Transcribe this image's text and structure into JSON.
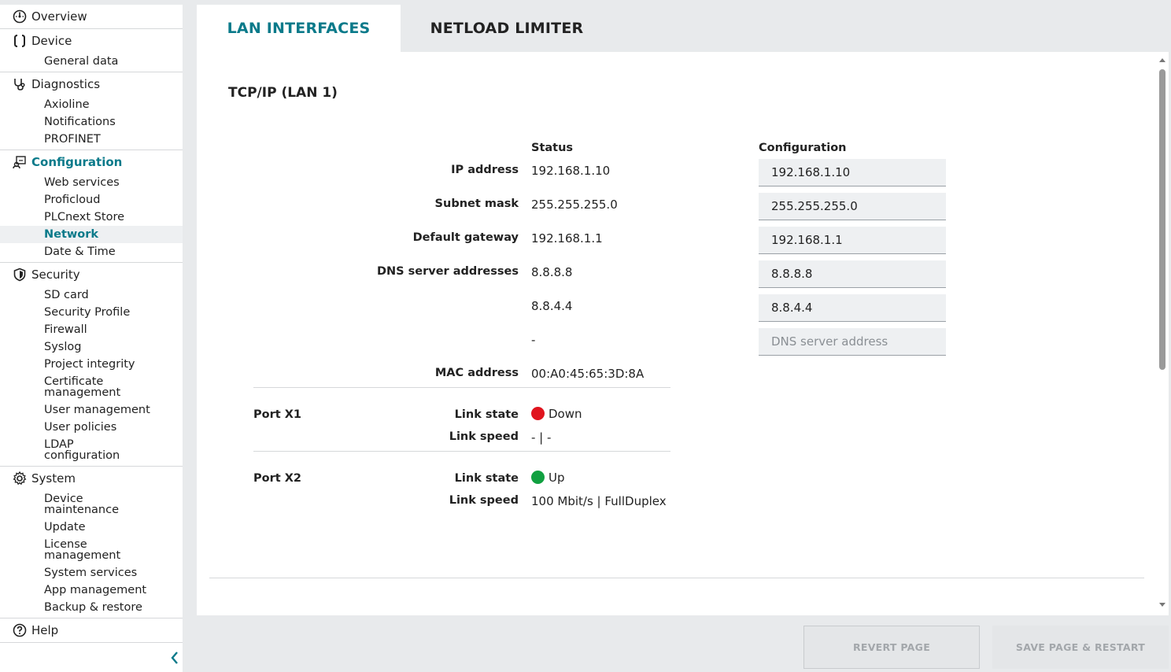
{
  "sidebar": {
    "groups": [
      {
        "label": "Overview",
        "icon": "dashboard-icon",
        "items": []
      },
      {
        "label": "Device",
        "icon": "braces-icon",
        "items": [
          "General data"
        ]
      },
      {
        "label": "Diagnostics",
        "icon": "stethoscope-icon",
        "items": [
          "Axioline",
          "Notifications",
          "PROFINET"
        ]
      },
      {
        "label": "Configuration",
        "icon": "config-icon",
        "items": [
          "Web services",
          "Proficloud",
          "PLCnext Store",
          "Network",
          "Date & Time"
        ]
      },
      {
        "label": "Security",
        "icon": "shield-icon",
        "items": [
          "SD card",
          "Security Profile",
          "Firewall",
          "Syslog",
          "Project integrity",
          "Certificate management",
          "User management",
          "User policies",
          "LDAP configuration"
        ]
      },
      {
        "label": "System",
        "icon": "gear-icon",
        "items": [
          "Device maintenance",
          "Update",
          "License management",
          "System services",
          "App management",
          "Backup & restore"
        ]
      },
      {
        "label": "Help",
        "icon": "help-icon",
        "items": []
      }
    ]
  },
  "tabs": {
    "lan": "LAN INTERFACES",
    "netload": "NETLOAD LIMITER"
  },
  "main": {
    "section_title": "TCP/IP (LAN 1)",
    "status_header": "Status",
    "config_header": "Configuration",
    "rows": {
      "ip_label": "IP address",
      "ip_status": "192.168.1.10",
      "ip_config": "192.168.1.10",
      "subnet_label": "Subnet mask",
      "subnet_status": "255.255.255.0",
      "subnet_config": "255.255.255.0",
      "gateway_label": "Default gateway",
      "gateway_status": "192.168.1.1",
      "gateway_config": "192.168.1.1",
      "dns_label": "DNS server addresses",
      "dns1_status": "8.8.8.8",
      "dns1_config": "8.8.8.8",
      "dns2_status": "8.8.4.4",
      "dns2_config": "8.8.4.4",
      "dns3_status": "-",
      "dns3_placeholder": "DNS server address",
      "mac_label": "MAC address",
      "mac_status": "00:A0:45:65:3D:8A"
    },
    "ports": [
      {
        "title": "Port X1",
        "link_state_label": "Link state",
        "link_state": "Down",
        "link_color": "#e0141e",
        "link_speed_label": "Link speed",
        "link_speed": "- | -"
      },
      {
        "title": "Port X2",
        "link_state_label": "Link state",
        "link_state": "Up",
        "link_color": "#10a040",
        "link_speed_label": "Link speed",
        "link_speed": "100 Mbit/s | FullDuplex"
      }
    ]
  },
  "footer": {
    "revert": "REVERT PAGE",
    "save": "SAVE PAGE & RESTART"
  },
  "colors": {
    "accent": "#0a7a8a"
  }
}
